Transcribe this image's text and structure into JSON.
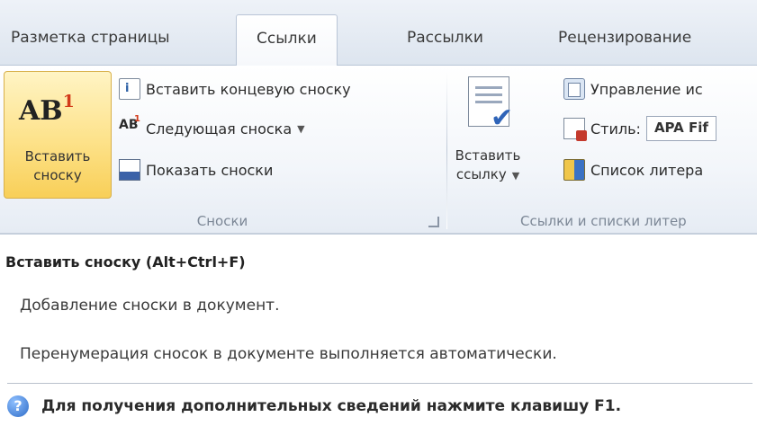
{
  "tabs": [
    {
      "label": "Разметка страницы",
      "active": false
    },
    {
      "label": "Ссылки",
      "active": true
    },
    {
      "label": "Рассылки",
      "active": false
    },
    {
      "label": "Рецензирование",
      "active": false
    }
  ],
  "ribbon": {
    "footnotes_group": {
      "label": "Сноски",
      "insert_footnote_line1": "Вставить",
      "insert_footnote_line2": "сноску",
      "insert_endnote": "Вставить концевую сноску",
      "next_footnote": "Следующая сноска",
      "show_notes": "Показать сноски"
    },
    "citations_group": {
      "label": "Ссылки и списки литер",
      "insert_citation_line1": "Вставить",
      "insert_citation_line2": "ссылку",
      "manage_sources": "Управление ис",
      "style_label": "Стиль:",
      "style_value": "APA Fif",
      "bibliography": "Список литера"
    }
  },
  "tooltip": {
    "title": "Вставить сноску (Alt+Ctrl+F)",
    "description": "Добавление сноски в документ.",
    "note": "Перенумерация сносок в документе выполняется автоматически.",
    "help": "Для получения дополнительных сведений нажмите клавишу F1."
  },
  "colors": {
    "highlight": "#fde28a",
    "ribbon_bg": "#f3f6fa",
    "help_icon": "#2e6cc7"
  }
}
